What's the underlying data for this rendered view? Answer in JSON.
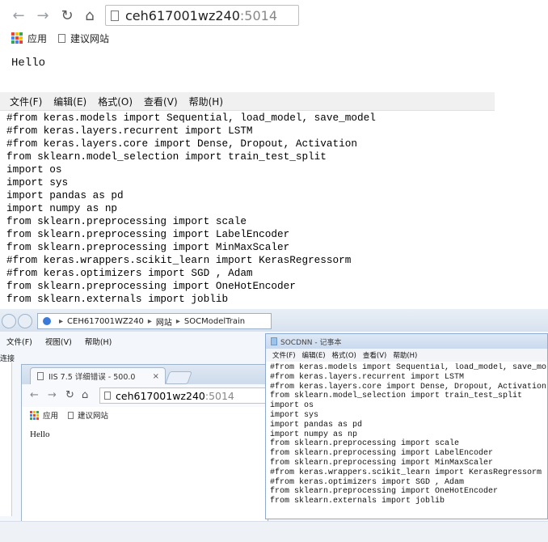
{
  "top_browser": {
    "address_host": "ceh617001wz240",
    "address_port": ":5014",
    "bookmarks": {
      "apps": "应用",
      "site": "建议网站"
    },
    "body_text": "Hello"
  },
  "top_notepad": {
    "menu": [
      "文件(F)",
      "编辑(E)",
      "格式(O)",
      "查看(V)",
      "帮助(H)"
    ],
    "lines": [
      "#from keras.models import Sequential, load_model, save_model",
      "#from keras.layers.recurrent import LSTM",
      "#from keras.layers.core import Dense, Dropout, Activation",
      "from sklearn.model_selection import train_test_split",
      "import os",
      "import sys",
      "import pandas as pd",
      "import numpy as np",
      "from sklearn.preprocessing import scale",
      "from sklearn.preprocessing import LabelEncoder",
      "from sklearn.preprocessing import MinMaxScaler",
      "#from keras.wrappers.scikit_learn import KerasRegressorm",
      "#from keras.optimizers import SGD , Adam",
      "from sklearn.preprocessing import OneHotEncoder",
      "from sklearn.externals import joblib"
    ]
  },
  "explorer": {
    "breadcrumb": [
      "CEH617001WZ240",
      "网站",
      "SOCModelTrain"
    ],
    "menu": [
      "文件(F)",
      "视图(V)",
      "帮助(H)"
    ],
    "side_link": "连接"
  },
  "inner_browser": {
    "tab_title": "IIS 7.5 详细错误 - 500.0",
    "tab_close": "×",
    "address_host": "ceh617001wz240",
    "address_port": ":5014",
    "bookmarks": {
      "apps": "应用",
      "site": "建议网站"
    },
    "body_text": "Hello"
  },
  "inner_notepad": {
    "title": "SOCDNN - 记事本",
    "menu": [
      "文件(F)",
      "编辑(E)",
      "格式(O)",
      "查看(V)",
      "帮助(H)"
    ],
    "lines": [
      "#from keras.models import Sequential, load_model, save_mo",
      "#from keras.layers.recurrent import LSTM",
      "#from keras.layers.core import Dense, Dropout, Activation",
      "from sklearn.model_selection import train_test_split",
      "import os",
      "import sys",
      "import pandas as pd",
      "import numpy as np",
      "from sklearn.preprocessing import scale",
      "from sklearn.preprocessing import LabelEncoder",
      "from sklearn.preprocessing import MinMaxScaler",
      "#from keras.wrappers.scikit_learn import KerasRegressorm",
      "#from keras.optimizers import SGD , Adam",
      "from sklearn.preprocessing import OneHotEncoder",
      "from sklearn.externals import joblib"
    ]
  },
  "colors": {
    "apps_grid": [
      "#ea4335",
      "#fbbc05",
      "#34a853",
      "#4285f4",
      "#ea4335",
      "#fbbc05",
      "#34a853",
      "#4285f4",
      "#ea4335"
    ]
  }
}
